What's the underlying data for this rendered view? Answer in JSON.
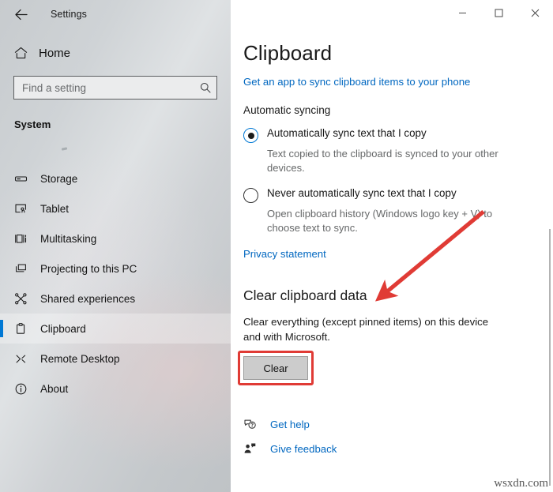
{
  "titlebar": {
    "back_icon": "back-arrow-icon",
    "title": "Settings",
    "minimize_icon": "minimize-icon",
    "maximize_icon": "maximize-icon",
    "close_icon": "close-icon"
  },
  "sidebar": {
    "home_label": "Home",
    "home_icon": "home-icon",
    "search": {
      "placeholder": "Find a setting",
      "value": "",
      "icon": "search-icon"
    },
    "group_title": "System",
    "items": [
      {
        "label": "Storage",
        "icon": "storage-icon",
        "selected": false
      },
      {
        "label": "Tablet",
        "icon": "tablet-icon",
        "selected": false
      },
      {
        "label": "Multitasking",
        "icon": "multitasking-icon",
        "selected": false
      },
      {
        "label": "Projecting to this PC",
        "icon": "projecting-icon",
        "selected": false
      },
      {
        "label": "Shared experiences",
        "icon": "shared-experiences-icon",
        "selected": false
      },
      {
        "label": "Clipboard",
        "icon": "clipboard-icon",
        "selected": true
      },
      {
        "label": "Remote Desktop",
        "icon": "remote-desktop-icon",
        "selected": false
      },
      {
        "label": "About",
        "icon": "info-icon",
        "selected": false
      }
    ]
  },
  "main": {
    "page_title": "Clipboard",
    "sync_app_link": "Get an app to sync clipboard items to your phone",
    "automatic_syncing": {
      "heading": "Automatic syncing",
      "options": [
        {
          "label": "Automatically sync text that I copy",
          "description": "Text copied to the clipboard is synced to your other devices.",
          "selected": true
        },
        {
          "label": "Never automatically sync text that I copy",
          "description": "Open clipboard history (Windows logo key + V) to choose text to sync.",
          "selected": false
        }
      ],
      "privacy_link": "Privacy statement"
    },
    "clear_section": {
      "heading": "Clear clipboard data",
      "description": "Clear everything (except pinned items) on this device and with Microsoft.",
      "button_label": "Clear"
    },
    "footer_links": [
      {
        "label": "Get help",
        "icon": "help-bubble-icon"
      },
      {
        "label": "Give feedback",
        "icon": "feedback-person-icon"
      }
    ]
  },
  "annotations": {
    "arrow_color": "#e03b35",
    "highlight_color": "#e03b35"
  },
  "watermark": "wsxdn.com",
  "colors": {
    "accent": "#0078d4",
    "link": "#0067c0",
    "sidebar_base": "#cfd3d6"
  }
}
